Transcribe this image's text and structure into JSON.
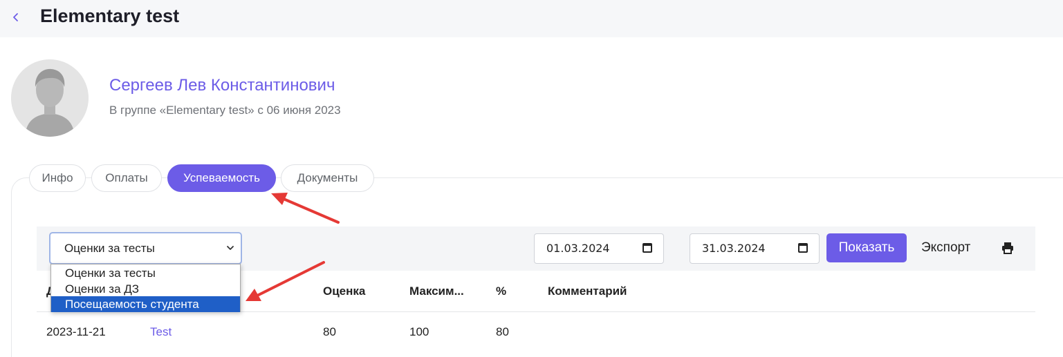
{
  "header": {
    "title": "Elementary test"
  },
  "student": {
    "name": "Сергеев Лев Константинович",
    "subtitle": "В группе «Elementary test» с 06 июня 2023"
  },
  "tabs": [
    {
      "label": "Инфо"
    },
    {
      "label": "Оплаты"
    },
    {
      "label": "Успеваемость"
    },
    {
      "label": "Документы"
    }
  ],
  "toolbar": {
    "select_value": "Оценки за тесты",
    "date_from": "01.03.2024",
    "date_to": "31.03.2024",
    "show_label": "Показать",
    "export_label": "Экспорт"
  },
  "dropdown": {
    "options": [
      "Оценки за тесты",
      "Оценки за ДЗ",
      "Посещаемость студента"
    ],
    "highlighted": "Посещаемость студента"
  },
  "table": {
    "columns": [
      "Д",
      "",
      "Оценка",
      "Максим...",
      "%",
      "Комментарий"
    ],
    "rows": [
      {
        "date": "2023-11-21",
        "name": "Test",
        "score": "80",
        "max": "100",
        "percent": "80",
        "comment": ""
      }
    ]
  },
  "colors": {
    "accent": "#6c5ce7",
    "highlight": "#1f5fc7",
    "annotation": "#e53935"
  }
}
